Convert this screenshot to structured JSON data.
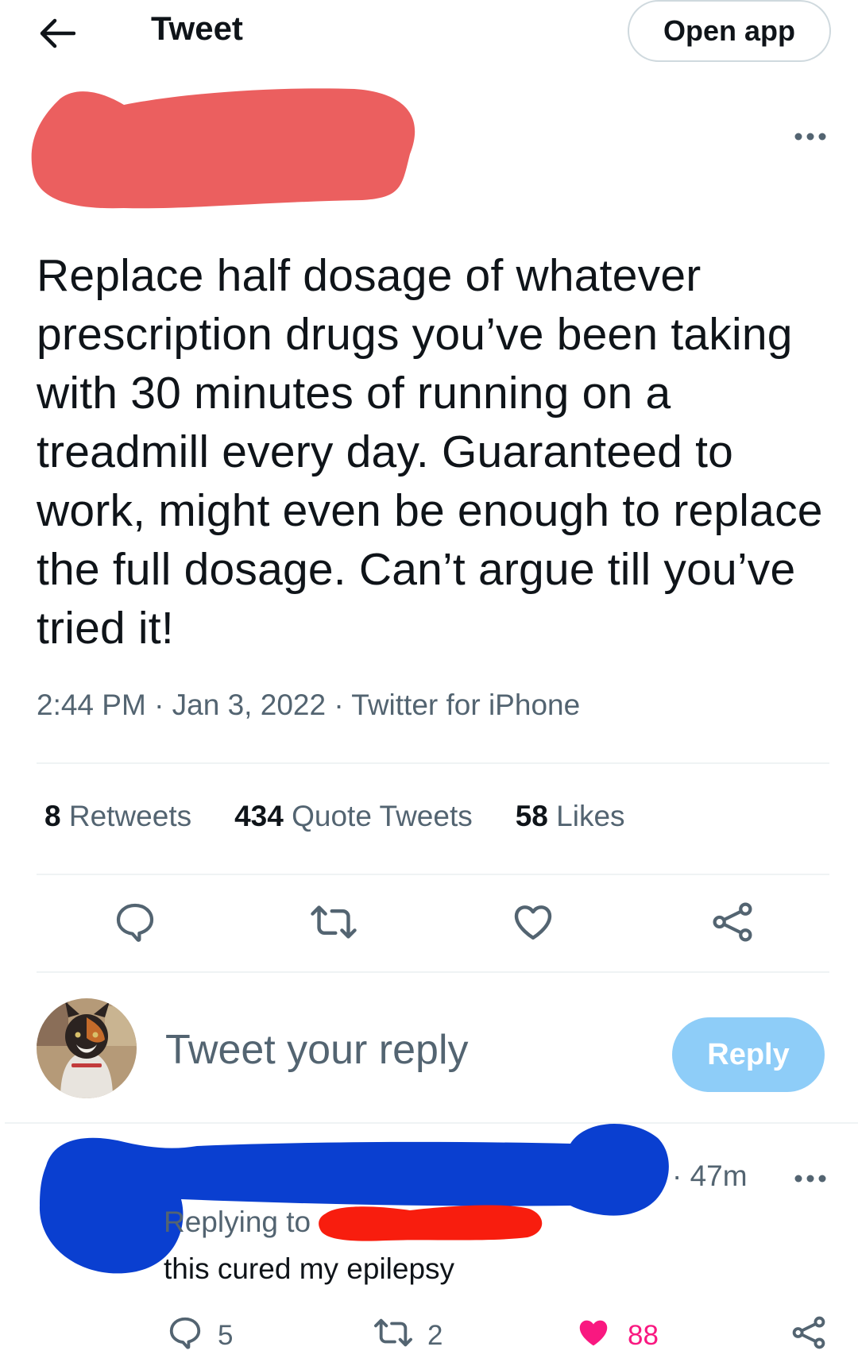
{
  "header": {
    "title": "Tweet",
    "open_app_label": "Open app"
  },
  "tweet": {
    "text": "Replace half dosage of whatever prescription drugs you’ve been taking with 30 minutes of running on a treadmill every day. Guaranteed to work, might even be enough to replace the full dosage. Can’t argue till you’ve tried it!",
    "meta": "2:44 PM · Jan 3, 2022 · Twitter for iPhone",
    "stats": {
      "retweets_count": "8",
      "retweets_label": "Retweets",
      "quotes_count": "434",
      "quotes_label": "Quote Tweets",
      "likes_count": "58",
      "likes_label": "Likes"
    }
  },
  "composer": {
    "placeholder": "Tweet your reply",
    "reply_label": "Reply"
  },
  "reply": {
    "time": "· 47m",
    "replying_to": "Replying to",
    "text": "this cured my epilepsy",
    "reply_count": "5",
    "retweet_count": "2",
    "like_count": "88"
  },
  "colors": {
    "accent": "#1d9bf0",
    "reply_button_disabled": "#8ecdf8",
    "like_active": "#f91880",
    "secondary_text": "#536471",
    "redaction_pink": "#eb5f5f",
    "redaction_blue": "#0a3fd0",
    "redaction_red": "#f81d0e"
  },
  "icons": [
    "back-arrow-icon",
    "more-dots-icon",
    "reply-icon",
    "retweet-icon",
    "heart-icon",
    "share-icon"
  ]
}
